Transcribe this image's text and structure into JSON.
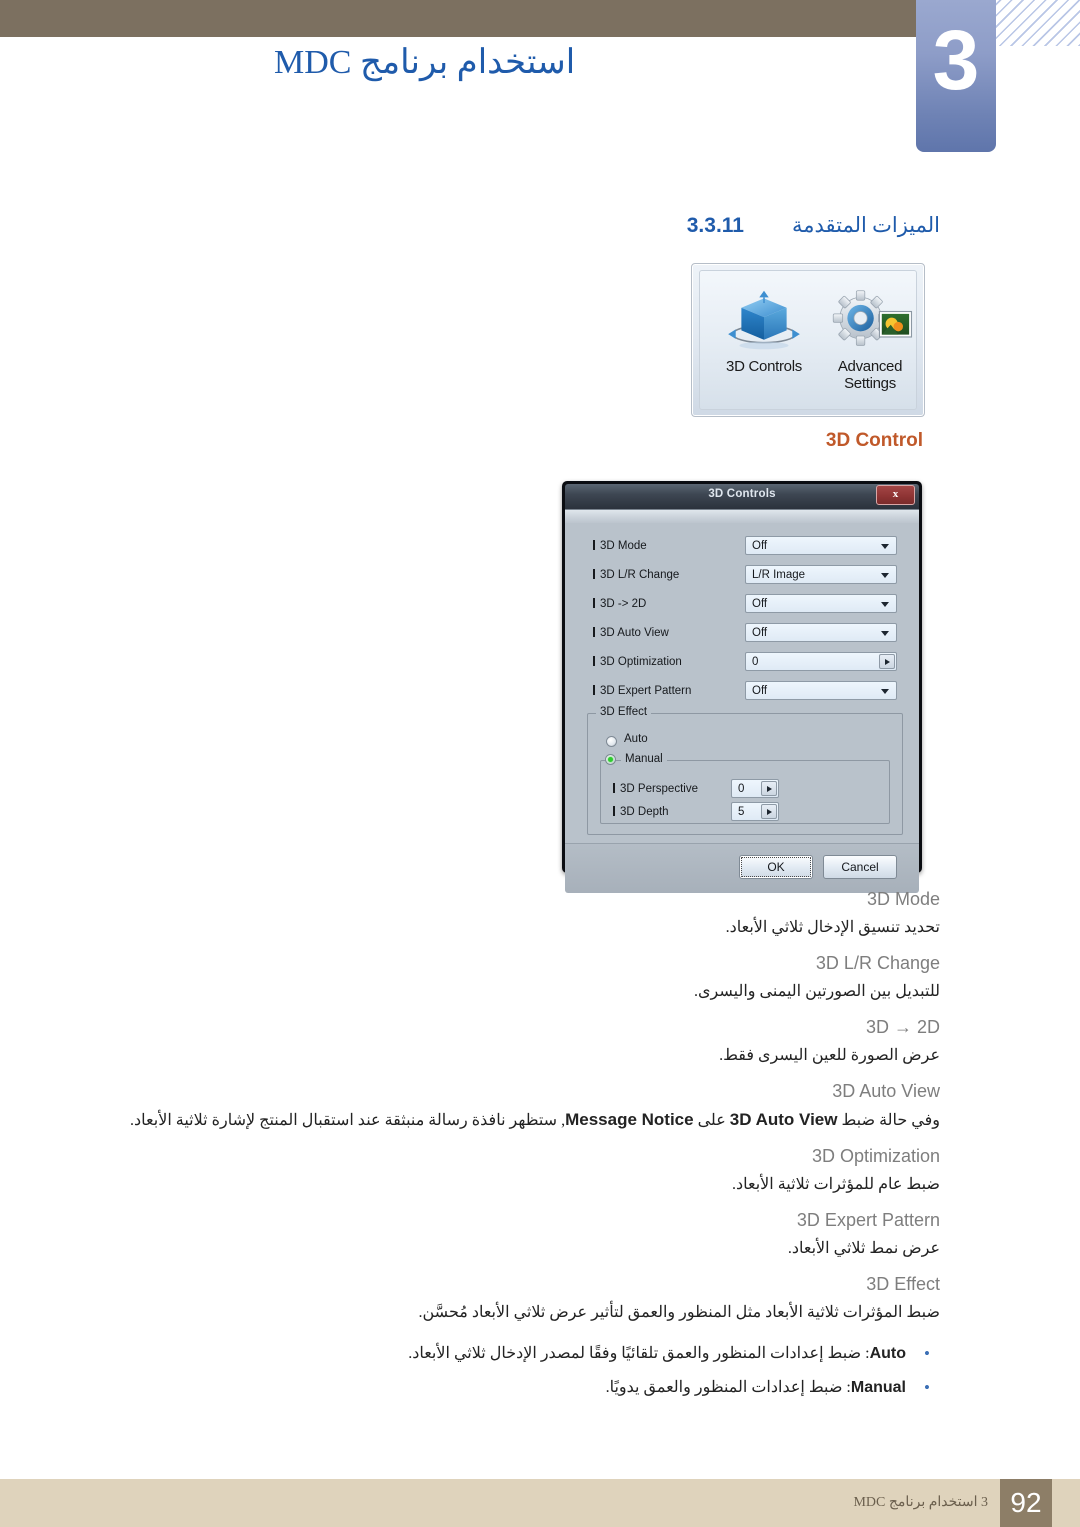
{
  "header": {
    "chapter_number": "3",
    "title": "استخدام برنامج MDC",
    "band_color": "#7c7060",
    "title_color": "#1f5bab"
  },
  "section": {
    "number": "3.3.11",
    "title": "الميزات المتقدمة"
  },
  "icon_panel": {
    "items": [
      {
        "label": "3D Controls",
        "icon": "cube-3d-icon"
      },
      {
        "label": "Advanced Settings",
        "icon": "gear-photo-icon"
      }
    ]
  },
  "caption": {
    "text": "3D Control",
    "color": "#c0592a"
  },
  "dialog": {
    "title": "3D Controls",
    "close_label": "x",
    "rows": [
      {
        "label": "3D Mode",
        "value": "Off",
        "control": "dropdown"
      },
      {
        "label": "3D L/R Change",
        "value": "L/R Image",
        "control": "dropdown"
      },
      {
        "label": "3D -> 2D",
        "value": "Off",
        "control": "dropdown"
      },
      {
        "label": "3D Auto View",
        "value": "Off",
        "control": "dropdown"
      },
      {
        "label": "3D Optimization",
        "value": "0",
        "control": "spinner"
      },
      {
        "label": "3D Expert Pattern",
        "value": "Off",
        "control": "dropdown"
      }
    ],
    "effect_group": {
      "legend": "3D Effect",
      "radios": [
        {
          "label": "Auto",
          "selected": false
        },
        {
          "label": "Manual",
          "selected": true
        }
      ],
      "manual_rows": [
        {
          "label": "3D Perspective",
          "value": "0",
          "control": "spinner"
        },
        {
          "label": "3D Depth",
          "value": "5",
          "control": "spinner"
        }
      ]
    },
    "buttons": {
      "ok": "OK",
      "cancel": "Cancel"
    }
  },
  "descriptions": [
    {
      "term": "3D Mode",
      "body": "تحديد تنسيق الإدخال ثلاثي الأبعاد."
    },
    {
      "term": "3D L/R Change",
      "body": "للتبديل بين الصورتين اليمنى واليسرى."
    },
    {
      "term": "3D → 2D",
      "body": "عرض الصورة للعين اليسرى فقط."
    },
    {
      "term": "3D Auto View",
      "body_pre": "وفي حالة ضبط ",
      "body_bold1": "3D Auto View",
      "body_mid": " على ",
      "body_bold2": "Message Notice",
      "body_post": ", ستظهر نافذة رسالة منبثقة عند استقبال المنتج لإشارة ثلاثية الأبعاد."
    },
    {
      "term": "3D Optimization",
      "body": "ضبط عام للمؤثرات ثلاثية الأبعاد."
    },
    {
      "term": "3D Expert Pattern",
      "body": "عرض نمط ثلاثي الأبعاد."
    },
    {
      "term": "3D Effect",
      "body": "ضبط المؤثرات ثلاثية الأبعاد مثل المنظور والعمق لتأثير عرض ثلاثي الأبعاد مُحسَّن."
    }
  ],
  "bullets": [
    {
      "term": "Auto",
      "text": ": ضبط إعدادات المنظور والعمق تلقائيًا وفقًا لمصدر الإدخال ثلاثي الأبعاد."
    },
    {
      "term": "Manual",
      "text": ": ضبط إعدادات المنظور والعمق يدويًا."
    }
  ],
  "footer": {
    "page_number": "92",
    "text": "3 استخدام برنامج MDC"
  }
}
